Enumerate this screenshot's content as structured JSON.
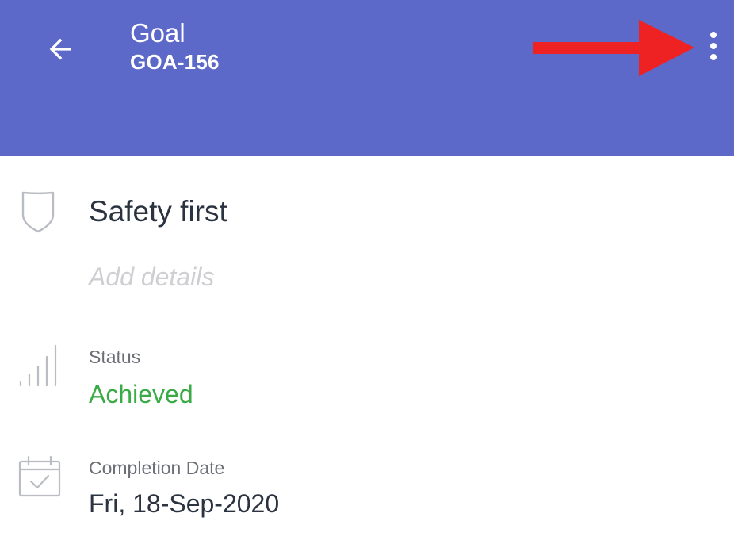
{
  "colors": {
    "app_bar": "#5c69c9",
    "on_app_bar": "#ffffff",
    "status_achieved": "#3aaa46",
    "annotation_arrow": "#ee2222"
  },
  "header": {
    "title": "Goal",
    "subtitle": "GOA-156",
    "back_icon": "arrow-left-icon",
    "menu_icon": "more-vertical-icon"
  },
  "goal": {
    "icon": "shield-icon",
    "name": "Safety first",
    "details_placeholder": "Add details"
  },
  "status": {
    "icon": "signal-bars-icon",
    "label": "Status",
    "value": "Achieved"
  },
  "completion": {
    "icon": "calendar-check-icon",
    "label": "Completion Date",
    "value": "Fri, 18-Sep-2020"
  }
}
